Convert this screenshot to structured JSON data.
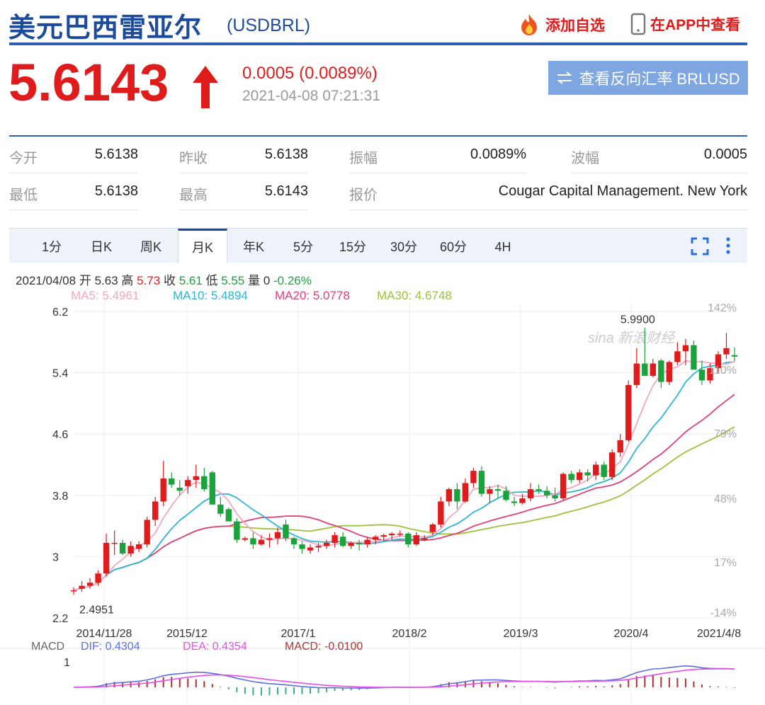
{
  "header": {
    "title": "美元巴西雷亚尔",
    "code": "(USDBRL)",
    "add_watchlist": "添加自选",
    "view_in_app": "在APP中查看"
  },
  "quote": {
    "price": "5.6143",
    "change": "0.0005 (0.0089%)",
    "time": "2021-04-08 07:21:31",
    "reverse_button": "查看反向汇率 BRLUSD",
    "up_color": "#e01b1b"
  },
  "stats": {
    "open_label": "今开",
    "open": "5.6138",
    "prev_close_label": "昨收",
    "prev_close": "5.6138",
    "amplitude_label": "振幅",
    "amplitude": "0.0089%",
    "wave_label": "波幅",
    "wave": "0.0005",
    "low_label": "最低",
    "low": "5.6138",
    "high_label": "最高",
    "high": "5.6143",
    "quote_label": "报价",
    "quote_source": "Cougar Capital Management. New York"
  },
  "tabs": [
    "1分",
    "日K",
    "周K",
    "月K",
    "年K",
    "5分",
    "15分",
    "30分",
    "60分",
    "4H"
  ],
  "active_tab": "月K",
  "info": {
    "date": "2021/04/08",
    "open_label": "开",
    "open": "5.63",
    "high_label": "高",
    "high": "5.73",
    "close_label": "收",
    "close": "5.61",
    "low_label": "低",
    "low": "5.55",
    "volume_label": "量",
    "volume": "0",
    "pct": "-0.26%"
  },
  "ma": {
    "ma5": "MA5: 5.4961",
    "ma10": "MA10: 5.4894",
    "ma20": "MA20: 5.0778",
    "ma30": "MA30: 4.6748",
    "ma5_color": "#f4a6c4",
    "ma10_color": "#2bb7d4",
    "ma20_color": "#e0407a",
    "ma30_color": "#9cc23a"
  },
  "macd": {
    "label": "MACD",
    "dif": "DIF: 0.4304",
    "dea": "DEA: 0.4354",
    "macd": "MACD: -0.0100",
    "dif_color": "#5a6ee8",
    "dea_color": "#e84ee8",
    "macd_color": "#b23232",
    "axis_label": "1"
  },
  "watermark": "sina 新浪财经",
  "chart_data": {
    "type": "candlestick",
    "ylim": [
      2.2,
      6.2
    ],
    "y_ticks": [
      "6.2",
      "5.4",
      "4.6",
      "3.8",
      "3",
      "2.2"
    ],
    "pct_ticks": [
      "142%",
      "110%",
      "79%",
      "48%",
      "17%",
      "-14%"
    ],
    "x_ticks": [
      "2014/11/28",
      "2015/12",
      "2017/1",
      "2018/2",
      "2019/3",
      "2020/4",
      "2021/4/8"
    ],
    "max_label": "5.9900",
    "min_label": "2.4951",
    "up_color": "#e01b1b",
    "down_color": "#1aa33a",
    "candles": [
      [
        2.56,
        2.6,
        2.5,
        2.56
      ],
      [
        2.58,
        2.68,
        2.54,
        2.62
      ],
      [
        2.62,
        2.72,
        2.58,
        2.66
      ],
      [
        2.66,
        2.82,
        2.62,
        2.78
      ],
      [
        2.78,
        3.3,
        2.74,
        3.18
      ],
      [
        3.18,
        3.34,
        3.02,
        3.18
      ],
      [
        3.18,
        3.22,
        3.02,
        3.04
      ],
      [
        3.04,
        3.2,
        3.0,
        3.14
      ],
      [
        3.1,
        3.2,
        3.06,
        3.16
      ],
      [
        3.16,
        3.52,
        3.12,
        3.48
      ],
      [
        3.48,
        3.78,
        3.4,
        3.72
      ],
      [
        3.72,
        4.25,
        3.66,
        4.02
      ],
      [
        4.02,
        4.1,
        3.9,
        3.94
      ],
      [
        3.9,
        4.0,
        3.8,
        3.86
      ],
      [
        3.92,
        4.05,
        3.82,
        4.0
      ],
      [
        4.0,
        4.2,
        3.9,
        4.05
      ],
      [
        4.05,
        4.16,
        3.85,
        3.88
      ],
      [
        4.1,
        4.12,
        3.78,
        3.68
      ],
      [
        3.68,
        3.78,
        3.52,
        3.56
      ],
      [
        3.62,
        3.64,
        3.48,
        3.46
      ],
      [
        3.46,
        3.5,
        3.18,
        3.22
      ],
      [
        3.22,
        3.26,
        3.2,
        3.24
      ],
      [
        3.24,
        3.32,
        3.1,
        3.16
      ],
      [
        3.16,
        3.28,
        3.14,
        3.22
      ],
      [
        3.22,
        3.3,
        3.12,
        3.24
      ],
      [
        3.24,
        3.38,
        3.16,
        3.32
      ],
      [
        3.42,
        3.48,
        3.2,
        3.24
      ],
      [
        3.24,
        3.26,
        3.1,
        3.16
      ],
      [
        3.16,
        3.2,
        3.04,
        3.1
      ],
      [
        3.08,
        3.16,
        3.04,
        3.12
      ],
      [
        3.12,
        3.18,
        3.06,
        3.14
      ],
      [
        3.14,
        3.22,
        3.1,
        3.18
      ],
      [
        3.18,
        3.32,
        3.12,
        3.28
      ],
      [
        3.26,
        3.32,
        3.12,
        3.14
      ],
      [
        3.14,
        3.2,
        3.1,
        3.18
      ],
      [
        3.18,
        3.22,
        3.08,
        3.16
      ],
      [
        3.16,
        3.26,
        3.12,
        3.22
      ],
      [
        3.22,
        3.28,
        3.16,
        3.26
      ],
      [
        3.26,
        3.3,
        3.2,
        3.28
      ],
      [
        3.28,
        3.32,
        3.22,
        3.3
      ],
      [
        3.3,
        3.34,
        3.26,
        3.3
      ],
      [
        3.3,
        3.32,
        3.12,
        3.16
      ],
      [
        3.16,
        3.32,
        3.14,
        3.28
      ],
      [
        3.22,
        3.28,
        3.2,
        3.24
      ],
      [
        3.32,
        3.44,
        3.28,
        3.42
      ],
      [
        3.42,
        3.78,
        3.38,
        3.72
      ],
      [
        3.72,
        3.9,
        3.66,
        3.88
      ],
      [
        3.88,
        3.96,
        3.62,
        3.72
      ],
      [
        3.72,
        4.02,
        3.7,
        3.96
      ],
      [
        3.96,
        4.16,
        3.9,
        4.12
      ],
      [
        4.12,
        4.18,
        3.78,
        3.82
      ],
      [
        3.82,
        3.92,
        3.7,
        3.88
      ],
      [
        3.88,
        3.94,
        3.76,
        3.86
      ],
      [
        3.86,
        3.92,
        3.72,
        3.74
      ],
      [
        3.72,
        3.78,
        3.66,
        3.7
      ],
      [
        3.7,
        3.82,
        3.68,
        3.76
      ],
      [
        3.76,
        3.96,
        3.72,
        3.88
      ],
      [
        3.88,
        3.94,
        3.82,
        3.86
      ],
      [
        3.86,
        3.92,
        3.76,
        3.8
      ],
      [
        3.8,
        3.9,
        3.72,
        3.76
      ],
      [
        3.76,
        4.1,
        3.74,
        4.08
      ],
      [
        4.08,
        4.12,
        3.96,
        4.0
      ],
      [
        4.0,
        4.14,
        3.96,
        4.1
      ],
      [
        4.1,
        4.14,
        3.98,
        4.06
      ],
      [
        4.06,
        4.24,
        4.0,
        4.2
      ],
      [
        4.2,
        4.24,
        4.0,
        4.04
      ],
      [
        4.04,
        4.4,
        4.0,
        4.36
      ],
      [
        4.36,
        4.6,
        4.3,
        4.52
      ],
      [
        4.52,
        5.3,
        4.5,
        5.24
      ],
      [
        5.24,
        5.72,
        5.2,
        5.52
      ],
      [
        5.52,
        5.99,
        5.36,
        5.36
      ],
      [
        5.36,
        5.58,
        5.34,
        5.52
      ],
      [
        5.56,
        5.58,
        5.2,
        5.28
      ],
      [
        5.28,
        5.56,
        5.24,
        5.54
      ],
      [
        5.54,
        5.8,
        5.5,
        5.68
      ],
      [
        5.68,
        5.84,
        5.5,
        5.76
      ],
      [
        5.76,
        5.82,
        5.5,
        5.44
      ],
      [
        5.44,
        5.56,
        5.24,
        5.3
      ],
      [
        5.3,
        5.52,
        5.26,
        5.46
      ],
      [
        5.46,
        5.68,
        5.4,
        5.64
      ],
      [
        5.64,
        5.92,
        5.58,
        5.72
      ],
      [
        5.63,
        5.73,
        5.55,
        5.61
      ]
    ]
  }
}
